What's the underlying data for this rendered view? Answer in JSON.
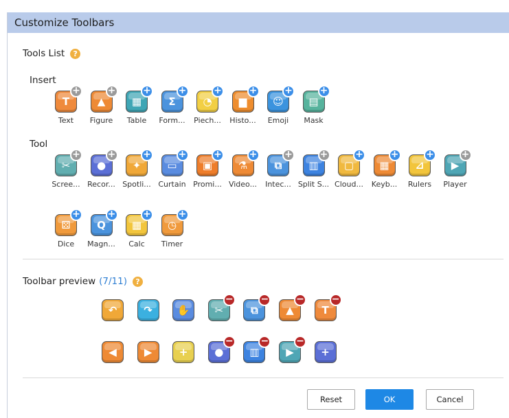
{
  "dialog": {
    "title": "Customize Toolbars"
  },
  "tools_list": {
    "label": "Tools List",
    "help": "?"
  },
  "insert": {
    "label": "Insert",
    "items": [
      {
        "label": "Text",
        "color": "#ef8a3c",
        "glyph": "T",
        "badge": "+",
        "badge_type": "gray"
      },
      {
        "label": "Figure",
        "color": "#ee8a35",
        "glyph": "▲",
        "badge": "+",
        "badge_type": "gray"
      },
      {
        "label": "Table",
        "color": "#3fa6b5",
        "glyph": "▦",
        "badge": "+",
        "badge_type": "add"
      },
      {
        "label": "Form...",
        "color": "#4b93dd",
        "glyph": "Σ",
        "badge": "+",
        "badge_type": "add"
      },
      {
        "label": "Piech...",
        "color": "#f2cf44",
        "glyph": "◔",
        "badge": "+",
        "badge_type": "add"
      },
      {
        "label": "Histo...",
        "color": "#ee8d2e",
        "glyph": "▆",
        "badge": "+",
        "badge_type": "add"
      },
      {
        "label": "Emoji",
        "color": "#3b93de",
        "glyph": "☺",
        "badge": "+",
        "badge_type": "add"
      },
      {
        "label": "Mask",
        "color": "#56b39d",
        "glyph": "▤",
        "badge": "+",
        "badge_type": "add"
      }
    ]
  },
  "tool": {
    "label": "Tool",
    "items": [
      {
        "label": "Scree...",
        "color": "#61aeb0",
        "glyph": "✂",
        "badge": "+",
        "badge_type": "gray"
      },
      {
        "label": "Recor...",
        "color": "#5b6fd6",
        "glyph": "●",
        "badge": "+",
        "badge_type": "gray"
      },
      {
        "label": "Spotli...",
        "color": "#f0a838",
        "glyph": "✦",
        "badge": "+",
        "badge_type": "add"
      },
      {
        "label": "Curtain",
        "color": "#5a8ce0",
        "glyph": "▭",
        "badge": "+",
        "badge_type": "add"
      },
      {
        "label": "Promi...",
        "color": "#ee7d2a",
        "glyph": "▣",
        "badge": "+",
        "badge_type": "add"
      },
      {
        "label": "Video...",
        "color": "#ee8a35",
        "glyph": "⚗",
        "badge": "+",
        "badge_type": "add"
      },
      {
        "label": "Intec...",
        "color": "#4b93dd",
        "glyph": "⧉",
        "badge": "+",
        "badge_type": "gray"
      },
      {
        "label": "Split S...",
        "color": "#3d83e0",
        "glyph": "▥",
        "badge": "+",
        "badge_type": "gray"
      },
      {
        "label": "Cloud...",
        "color": "#f0b93f",
        "glyph": "▢",
        "badge": "+",
        "badge_type": "add"
      },
      {
        "label": "Keyb...",
        "color": "#ee8a35",
        "glyph": "▦",
        "badge": "+",
        "badge_type": "add"
      },
      {
        "label": "Rulers",
        "color": "#f2c53c",
        "glyph": "⊿",
        "badge": "+",
        "badge_type": "add"
      },
      {
        "label": "Player",
        "color": "#4fa6b5",
        "glyph": "▶",
        "badge": "+",
        "badge_type": "gray"
      },
      {
        "label": "Dice",
        "color": "#f09a3c",
        "glyph": "⚄",
        "badge": "+",
        "badge_type": "add"
      },
      {
        "label": "Magn...",
        "color": "#4b93dd",
        "glyph": "Q",
        "badge": "+",
        "badge_type": "add"
      },
      {
        "label": "Calc",
        "color": "#f2c53c",
        "glyph": "▦",
        "badge": "+",
        "badge_type": "add"
      },
      {
        "label": "Timer",
        "color": "#f09a3c",
        "glyph": "◷",
        "badge": "+",
        "badge_type": "add"
      }
    ]
  },
  "preview": {
    "label": "Toolbar preview",
    "count": "(7/11)",
    "help": "?",
    "row1": [
      {
        "name": "undo",
        "color": "#f0a838",
        "glyph": "↶",
        "badge": ""
      },
      {
        "name": "redo",
        "color": "#3bb0e0",
        "glyph": "↷",
        "badge": ""
      },
      {
        "name": "hand",
        "color": "#5a8ce0",
        "glyph": "✋",
        "badge": ""
      },
      {
        "name": "screenshot",
        "color": "#61aeb0",
        "glyph": "✂",
        "badge": "−"
      },
      {
        "name": "interactive",
        "color": "#4b93dd",
        "glyph": "⧉",
        "badge": "−"
      },
      {
        "name": "figure",
        "color": "#ee8a35",
        "glyph": "▲",
        "badge": "−"
      },
      {
        "name": "text",
        "color": "#ef8a3c",
        "glyph": "T",
        "badge": "−"
      }
    ],
    "row2": [
      {
        "name": "prev-page",
        "color": "#ee8a35",
        "glyph": "◀",
        "badge": ""
      },
      {
        "name": "next-page",
        "color": "#ee8a35",
        "glyph": "▶",
        "badge": ""
      },
      {
        "name": "add-page",
        "color": "#e8d050",
        "glyph": "+",
        "badge": ""
      },
      {
        "name": "record",
        "color": "#5b6fd6",
        "glyph": "●",
        "badge": "−"
      },
      {
        "name": "split",
        "color": "#3d83e0",
        "glyph": "▥",
        "badge": "−"
      },
      {
        "name": "player",
        "color": "#4fa6b5",
        "glyph": "▶",
        "badge": "−"
      },
      {
        "name": "add",
        "color": "#5b6fd6",
        "glyph": "+",
        "badge": ""
      }
    ]
  },
  "buttons": {
    "reset": "Reset",
    "ok": "OK",
    "cancel": "Cancel"
  }
}
